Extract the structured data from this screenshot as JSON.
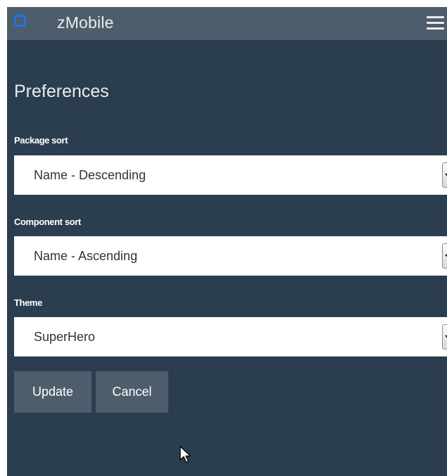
{
  "navbar": {
    "brand": "zMobile",
    "logo_icon": "square-logo-icon",
    "menu_icon": "hamburger-menu-icon"
  },
  "page": {
    "title": "Preferences"
  },
  "form": {
    "package_sort": {
      "label": "Package sort",
      "value": "Name - Descending"
    },
    "component_sort": {
      "label": "Component sort",
      "value": "Name - Ascending"
    },
    "theme": {
      "label": "Theme",
      "value": "SuperHero"
    }
  },
  "buttons": {
    "update": "Update",
    "cancel": "Cancel"
  },
  "colors": {
    "background": "#2b3e50",
    "navbar": "#4e5d6c",
    "button": "#4e5d6c",
    "logo": "#1e73e8",
    "text": "#ebebeb"
  }
}
